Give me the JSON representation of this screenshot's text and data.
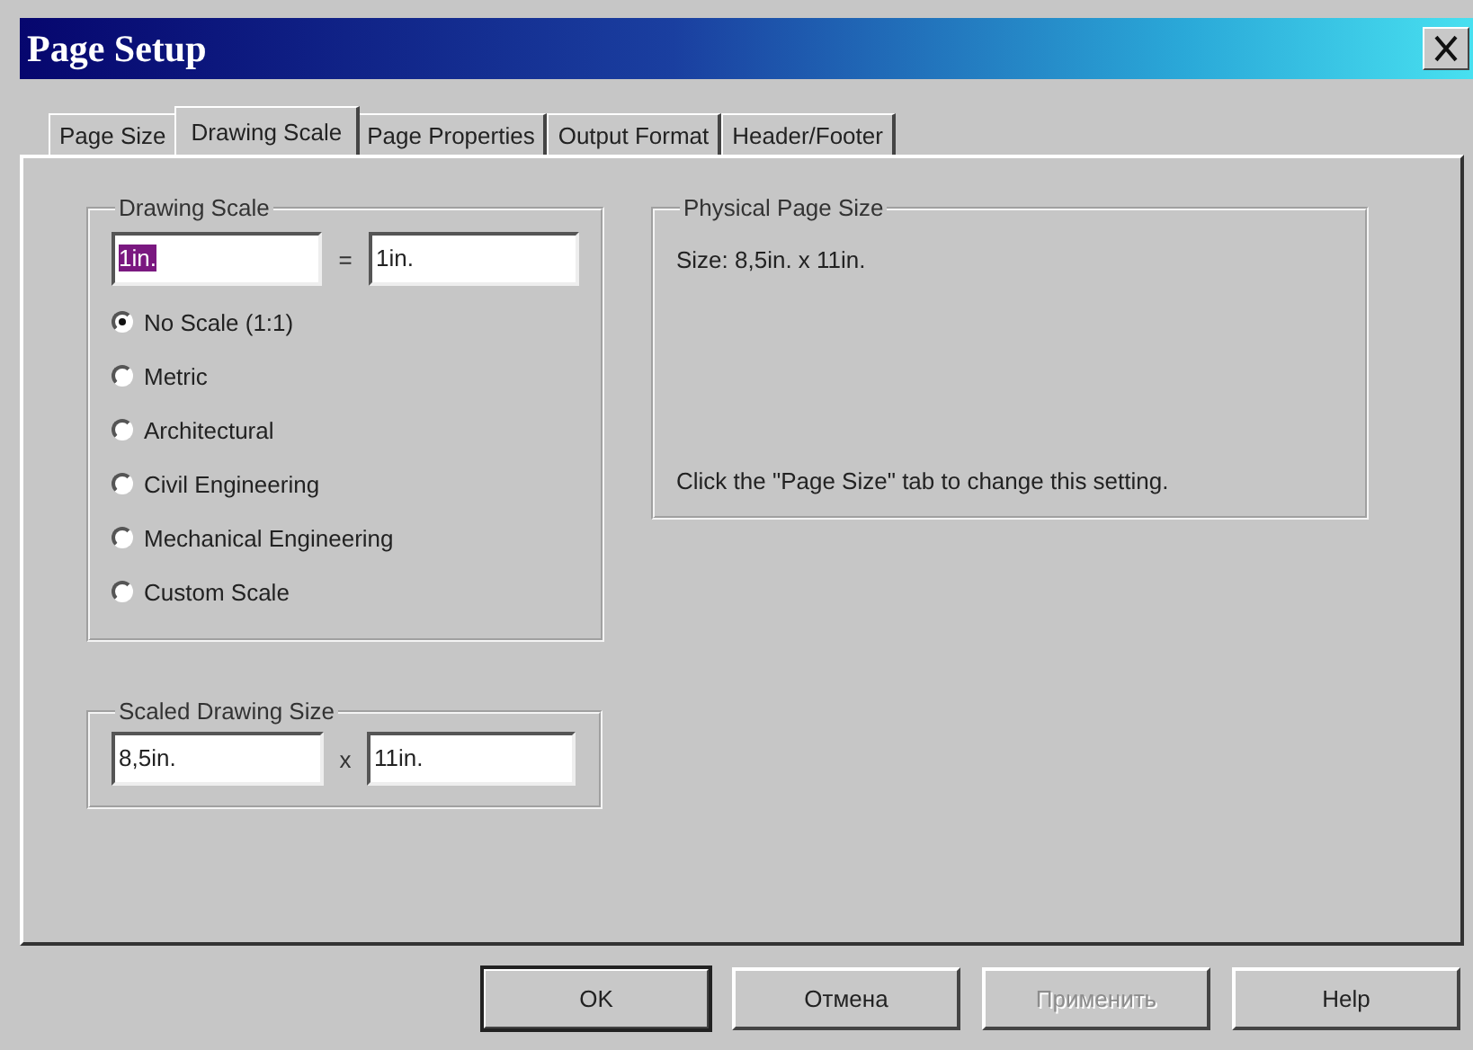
{
  "window": {
    "title": "Page Setup"
  },
  "tabs": [
    {
      "label": "Page Size",
      "selected": false
    },
    {
      "label": "Drawing Scale",
      "selected": true
    },
    {
      "label": "Page Properties",
      "selected": false
    },
    {
      "label": "Output Format",
      "selected": false
    },
    {
      "label": "Header/Footer",
      "selected": false
    }
  ],
  "drawing_scale": {
    "title": "Drawing Scale",
    "from_field": {
      "value": "1in.",
      "text_selected": true
    },
    "separator": "=",
    "to_field": {
      "value": "1in.",
      "text_selected": false
    },
    "options": [
      {
        "label": "No Scale (1:1)",
        "selected": true
      },
      {
        "label": "Metric",
        "selected": false
      },
      {
        "label": "Architectural",
        "selected": false
      },
      {
        "label": "Civil Engineering",
        "selected": false
      },
      {
        "label": "Mechanical Engineering",
        "selected": false
      },
      {
        "label": "Custom Scale",
        "selected": false
      }
    ]
  },
  "scaled_drawing_size": {
    "title": "Scaled Drawing Size",
    "width_field": {
      "value": "8,5in.",
      "text_selected": false
    },
    "separator": "x",
    "height_field": {
      "value": "11in.",
      "text_selected": false
    }
  },
  "physical_page_size": {
    "title": "Physical Page Size",
    "size": "Size: 8,5in. x 11in.",
    "hint": "Click the \"Page Size\" tab to change this setting."
  },
  "buttons": [
    {
      "label": "OK",
      "default": true,
      "disabled": false
    },
    {
      "label": "Отмена",
      "default": false,
      "disabled": false
    },
    {
      "label": "Применить",
      "default": false,
      "disabled": true
    },
    {
      "label": "Help",
      "default": false,
      "disabled": false
    }
  ]
}
